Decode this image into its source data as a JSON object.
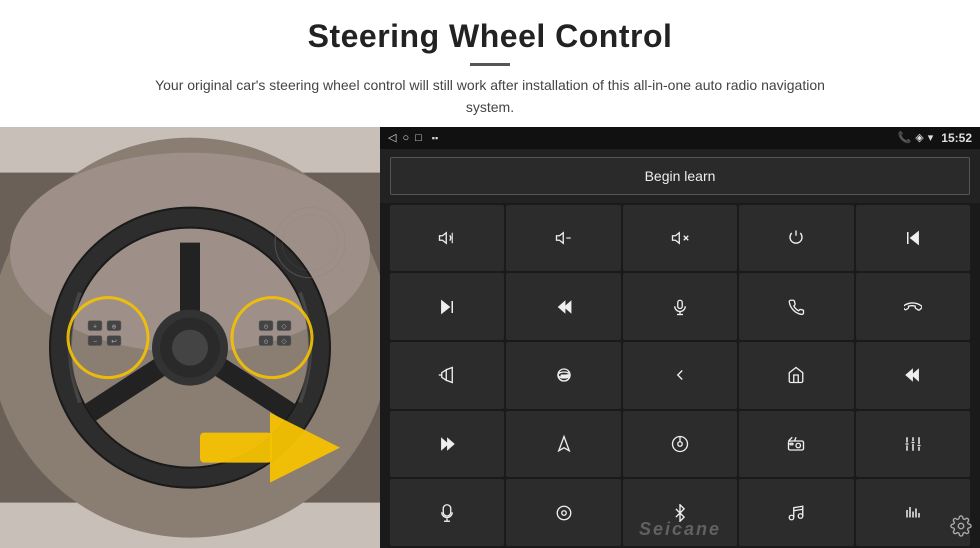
{
  "header": {
    "title": "Steering Wheel Control",
    "subtitle": "Your original car's steering wheel control will still work after installation of this all-in-one auto radio navigation system."
  },
  "status_bar": {
    "back_icon": "◁",
    "home_icon": "○",
    "recents_icon": "□",
    "battery_icon": "▪▪",
    "phone_icon": "📞",
    "location_icon": "◈",
    "wifi_icon": "▾",
    "time": "15:52"
  },
  "begin_learn": {
    "label": "Begin learn"
  },
  "controls": [
    {
      "icon": "vol_up",
      "unicode": "🔊+",
      "label": "Volume Up"
    },
    {
      "icon": "vol_down",
      "unicode": "🔉−",
      "label": "Volume Down"
    },
    {
      "icon": "mute",
      "unicode": "🔇",
      "label": "Mute"
    },
    {
      "icon": "power",
      "unicode": "⏻",
      "label": "Power"
    },
    {
      "icon": "prev_track",
      "unicode": "⏮",
      "label": "Previous Track"
    },
    {
      "icon": "next_track",
      "unicode": "⏭",
      "label": "Next Track"
    },
    {
      "icon": "fast_fwd_skip",
      "unicode": "⏭",
      "label": "Fast Forward"
    },
    {
      "icon": "microphone",
      "unicode": "🎤",
      "label": "Microphone"
    },
    {
      "icon": "phone",
      "unicode": "📞",
      "label": "Phone"
    },
    {
      "icon": "hang_up",
      "unicode": "📵",
      "label": "Hang Up"
    },
    {
      "icon": "horn",
      "unicode": "📣",
      "label": "Horn"
    },
    {
      "icon": "camera_360",
      "unicode": "⊙",
      "label": "360 Camera"
    },
    {
      "icon": "back",
      "unicode": "↩",
      "label": "Back"
    },
    {
      "icon": "home",
      "unicode": "⌂",
      "label": "Home"
    },
    {
      "icon": "rewind",
      "unicode": "⏮",
      "label": "Rewind"
    },
    {
      "icon": "fast_forward",
      "unicode": "⏭",
      "label": "Fast Forward"
    },
    {
      "icon": "navigation",
      "unicode": "▶",
      "label": "Navigation"
    },
    {
      "icon": "media",
      "unicode": "⏺",
      "label": "Media"
    },
    {
      "icon": "radio",
      "unicode": "📻",
      "label": "Radio"
    },
    {
      "icon": "equalizer",
      "unicode": "⚌",
      "label": "Equalizer"
    },
    {
      "icon": "mic2",
      "unicode": "🎤",
      "label": "Microphone 2"
    },
    {
      "icon": "settings_round",
      "unicode": "⚙",
      "label": "Settings"
    },
    {
      "icon": "bluetooth",
      "unicode": "✦",
      "label": "Bluetooth"
    },
    {
      "icon": "music",
      "unicode": "♪",
      "label": "Music"
    },
    {
      "icon": "sound_bars",
      "unicode": "▐",
      "label": "Sound Bars"
    }
  ],
  "watermark": "Seicane",
  "gear_label": "⚙"
}
